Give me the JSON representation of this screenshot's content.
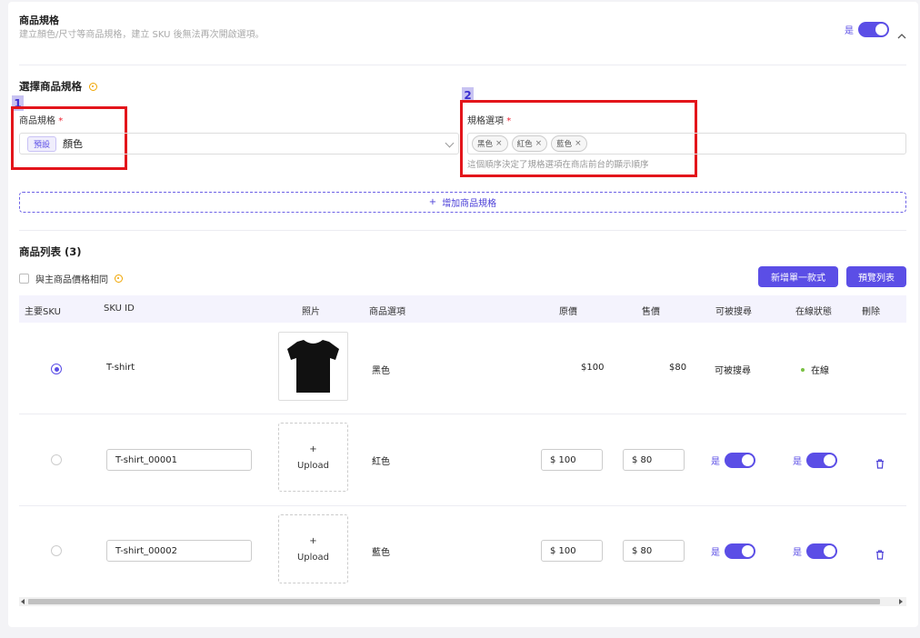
{
  "spec": {
    "title": "商品規格",
    "subtitle": "建立顏色/尺寸等商品規格，建立 SKU 後無法再次開啟選項。",
    "toggle_label": "是"
  },
  "select_spec": {
    "title": "選擇商品規格",
    "badge1": "1",
    "badge2": "2",
    "spec_label": "商品規格",
    "required_mark": "*",
    "preset_tag": "預設",
    "spec_value": "顏色",
    "options_label": "規格選項",
    "options": [
      "黑色",
      "紅色",
      "藍色"
    ],
    "options_hint": "這個順序決定了規格選項在商店前台的顯示順序",
    "add_button": "增加商品規格",
    "add_icon": "+"
  },
  "product_list": {
    "title": "商品列表 (3)",
    "same_price_label": "與主商品價格相同",
    "new_single_button": "新增單一款式",
    "preview_button": "預覽列表",
    "columns": [
      "主要SKU",
      "SKU ID",
      "照片",
      "商品選項",
      "原價",
      "售價",
      "可被搜尋",
      "在線狀態",
      "刪除"
    ],
    "rows": [
      {
        "sku": "T-shirt",
        "option": "黑色",
        "price": "$100",
        "sale": "$80",
        "searchable": "可被搜尋",
        "status": "在線"
      },
      {
        "sku": "T-shirt_00001",
        "option": "紅色",
        "price": "$ 100",
        "sale": "$ 80",
        "toggle": "是",
        "upload_plus": "+",
        "upload_label": "Upload"
      },
      {
        "sku": "T-shirt_00002",
        "option": "藍色",
        "price": "$ 100",
        "sale": "$ 80",
        "toggle": "是",
        "upload_plus": "+",
        "upload_label": "Upload"
      }
    ]
  },
  "colors": {
    "accent": "#5b4ee6",
    "annotation_red": "#e3151b",
    "badge_bg": "#c8c3f2"
  }
}
